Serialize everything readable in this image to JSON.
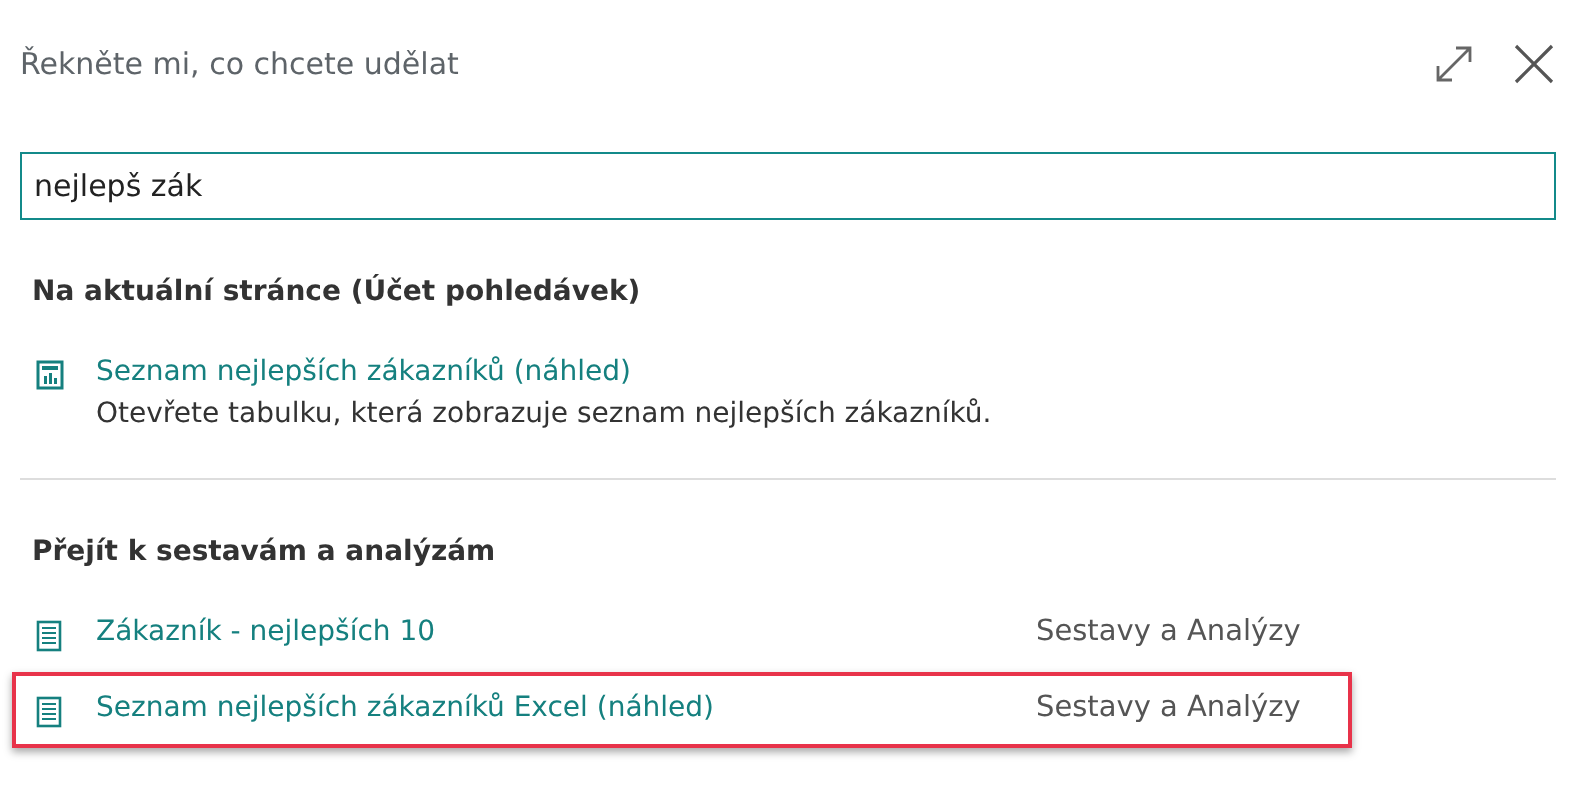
{
  "dialog": {
    "title": "Řekněte mi, co chcete udělat"
  },
  "search": {
    "value": "nejlepš zák"
  },
  "sections": [
    {
      "heading": "Na aktuální stránce (Účet pohledávek)",
      "items": [
        {
          "kind": "page",
          "label": "Seznam nejlepších zákazníků (náhled)",
          "description": "Otevřete tabulku, která zobrazuje seznam nejlepších zákazníků.",
          "highlighted": false
        }
      ]
    },
    {
      "heading": "Přejít k sestavám a analýzám",
      "items": [
        {
          "kind": "report",
          "label": "Zákazník - nejlepších 10",
          "category": "Sestavy a Analýzy",
          "highlighted": false
        },
        {
          "kind": "report",
          "label": "Seznam nejlepších zákazníků Excel (náhled)",
          "category": "Sestavy a Analýzy",
          "highlighted": true
        }
      ]
    }
  ]
}
